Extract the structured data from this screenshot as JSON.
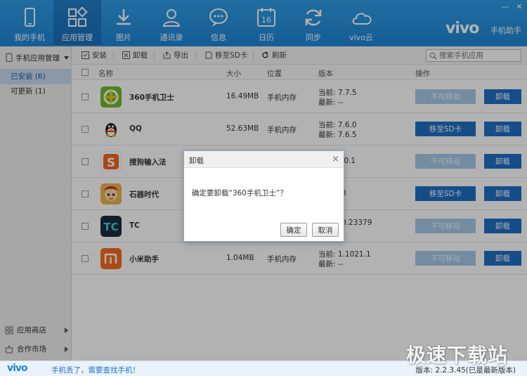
{
  "window": {
    "minimize_label": "—",
    "close_label": "✕"
  },
  "brand": {
    "logo": "vivo",
    "subtitle": "手机助手"
  },
  "nav": [
    {
      "label": "我的手机",
      "icon": "phone-icon"
    },
    {
      "label": "应用管理",
      "icon": "apps-icon",
      "active": true
    },
    {
      "label": "图片",
      "icon": "download-icon"
    },
    {
      "label": "通讯录",
      "icon": "contacts-icon"
    },
    {
      "label": "信息",
      "icon": "message-icon"
    },
    {
      "label": "日历",
      "icon": "calendar-icon",
      "calendar_day": "16"
    },
    {
      "label": "同步",
      "icon": "sync-icon"
    },
    {
      "label": "vivo云",
      "icon": "cloud-icon"
    }
  ],
  "sidebar": {
    "header": "手机应用管理",
    "items": [
      {
        "label": "已安装 (6)",
        "active": true
      },
      {
        "label": "可更新 (1)"
      }
    ],
    "bottom": [
      {
        "label": "应用商店",
        "icon": "store-icon"
      },
      {
        "label": "合作市场",
        "icon": "basket-icon"
      }
    ]
  },
  "toolbar": {
    "install": "安装",
    "uninstall": "卸载",
    "export": "导出",
    "move_sd": "移至SD卡",
    "refresh": "刷新",
    "search_placeholder": "搜索手机应用"
  },
  "table": {
    "headers": {
      "name": "名称",
      "size": "大小",
      "location": "位置",
      "version": "版本",
      "action": "操作"
    },
    "rows": [
      {
        "name": "360手机卫士",
        "size": "16.49MB",
        "location": "手机内存",
        "current": "当前: 7.7.5",
        "latest": "最新: --",
        "move": "不可移动",
        "move_enabled": false,
        "uninstall": "卸载",
        "icon": "360-security-icon"
      },
      {
        "name": "QQ",
        "size": "52.63MB",
        "location": "手机内存",
        "current": "当前: 7.6.0",
        "latest": "最新: 7.6.5",
        "move": "移至SD卡",
        "move_enabled": true,
        "uninstall": "卸载",
        "icon": "qq-penguin-icon"
      },
      {
        "name": "搜狗输入法",
        "size": "",
        "location": "",
        "current": ".0.1",
        "latest": "",
        "move": "不可移动",
        "move_enabled": false,
        "uninstall": "卸载",
        "icon": "sogou-input-icon"
      },
      {
        "name": "石器时代",
        "size": "",
        "location": "",
        "current": "8",
        "latest": "",
        "move": "移至SD卡",
        "move_enabled": true,
        "uninstall": "卸载",
        "icon": "stone-age-icon"
      },
      {
        "name": "TC",
        "size": "",
        "location": "",
        "current": "0.23379",
        "latest": "",
        "move": "不可移动",
        "move_enabled": false,
        "uninstall": "卸载",
        "icon": "tc-icon"
      },
      {
        "name": "小米助手",
        "size": "1.04MB",
        "location": "手机内存",
        "current": "当前: 1.1021.1",
        "latest": "最新: --",
        "move": "不可移动",
        "move_enabled": false,
        "uninstall": "卸载",
        "icon": "mi-icon"
      }
    ]
  },
  "dialog": {
    "title": "卸载",
    "message": "确定要卸载“360手机卫士”？",
    "ok": "确定",
    "cancel": "取消",
    "close_label": "×"
  },
  "statusbar": {
    "logo": "vivo",
    "link": "手机丢了，需要查找手机！",
    "version": "版本: 2.2.3.45(已是最新版本)"
  },
  "watermark": "极速下载站",
  "colors": {
    "topbar": "#2088d8",
    "button_blue": "#1f6fc4",
    "button_disabled": "#a7c9e8"
  }
}
